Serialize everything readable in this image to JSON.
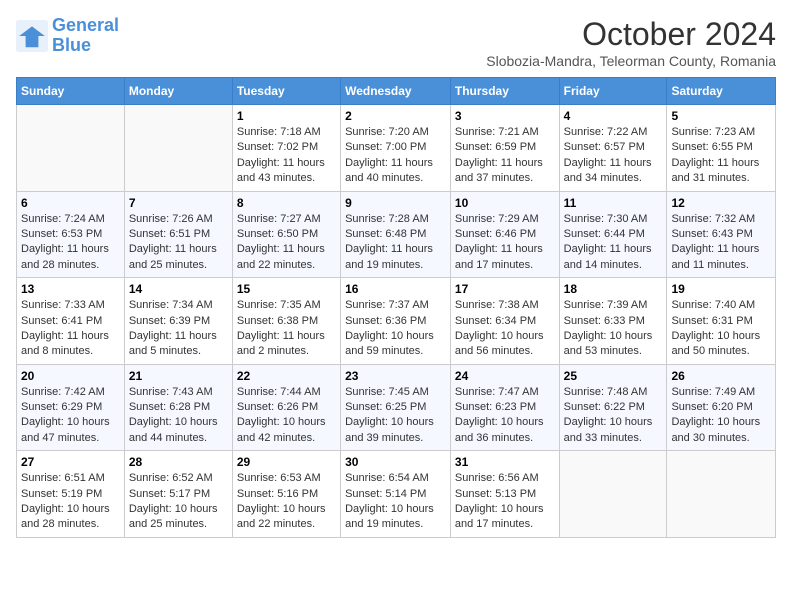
{
  "logo": {
    "line1": "General",
    "line2": "Blue"
  },
  "title": "October 2024",
  "subtitle": "Slobozia-Mandra, Teleorman County, Romania",
  "days_of_week": [
    "Sunday",
    "Monday",
    "Tuesday",
    "Wednesday",
    "Thursday",
    "Friday",
    "Saturday"
  ],
  "weeks": [
    [
      {
        "day": "",
        "sunrise": "",
        "sunset": "",
        "daylight": ""
      },
      {
        "day": "",
        "sunrise": "",
        "sunset": "",
        "daylight": ""
      },
      {
        "day": "1",
        "sunrise": "Sunrise: 7:18 AM",
        "sunset": "Sunset: 7:02 PM",
        "daylight": "Daylight: 11 hours and 43 minutes."
      },
      {
        "day": "2",
        "sunrise": "Sunrise: 7:20 AM",
        "sunset": "Sunset: 7:00 PM",
        "daylight": "Daylight: 11 hours and 40 minutes."
      },
      {
        "day": "3",
        "sunrise": "Sunrise: 7:21 AM",
        "sunset": "Sunset: 6:59 PM",
        "daylight": "Daylight: 11 hours and 37 minutes."
      },
      {
        "day": "4",
        "sunrise": "Sunrise: 7:22 AM",
        "sunset": "Sunset: 6:57 PM",
        "daylight": "Daylight: 11 hours and 34 minutes."
      },
      {
        "day": "5",
        "sunrise": "Sunrise: 7:23 AM",
        "sunset": "Sunset: 6:55 PM",
        "daylight": "Daylight: 11 hours and 31 minutes."
      }
    ],
    [
      {
        "day": "6",
        "sunrise": "Sunrise: 7:24 AM",
        "sunset": "Sunset: 6:53 PM",
        "daylight": "Daylight: 11 hours and 28 minutes."
      },
      {
        "day": "7",
        "sunrise": "Sunrise: 7:26 AM",
        "sunset": "Sunset: 6:51 PM",
        "daylight": "Daylight: 11 hours and 25 minutes."
      },
      {
        "day": "8",
        "sunrise": "Sunrise: 7:27 AM",
        "sunset": "Sunset: 6:50 PM",
        "daylight": "Daylight: 11 hours and 22 minutes."
      },
      {
        "day": "9",
        "sunrise": "Sunrise: 7:28 AM",
        "sunset": "Sunset: 6:48 PM",
        "daylight": "Daylight: 11 hours and 19 minutes."
      },
      {
        "day": "10",
        "sunrise": "Sunrise: 7:29 AM",
        "sunset": "Sunset: 6:46 PM",
        "daylight": "Daylight: 11 hours and 17 minutes."
      },
      {
        "day": "11",
        "sunrise": "Sunrise: 7:30 AM",
        "sunset": "Sunset: 6:44 PM",
        "daylight": "Daylight: 11 hours and 14 minutes."
      },
      {
        "day": "12",
        "sunrise": "Sunrise: 7:32 AM",
        "sunset": "Sunset: 6:43 PM",
        "daylight": "Daylight: 11 hours and 11 minutes."
      }
    ],
    [
      {
        "day": "13",
        "sunrise": "Sunrise: 7:33 AM",
        "sunset": "Sunset: 6:41 PM",
        "daylight": "Daylight: 11 hours and 8 minutes."
      },
      {
        "day": "14",
        "sunrise": "Sunrise: 7:34 AM",
        "sunset": "Sunset: 6:39 PM",
        "daylight": "Daylight: 11 hours and 5 minutes."
      },
      {
        "day": "15",
        "sunrise": "Sunrise: 7:35 AM",
        "sunset": "Sunset: 6:38 PM",
        "daylight": "Daylight: 11 hours and 2 minutes."
      },
      {
        "day": "16",
        "sunrise": "Sunrise: 7:37 AM",
        "sunset": "Sunset: 6:36 PM",
        "daylight": "Daylight: 10 hours and 59 minutes."
      },
      {
        "day": "17",
        "sunrise": "Sunrise: 7:38 AM",
        "sunset": "Sunset: 6:34 PM",
        "daylight": "Daylight: 10 hours and 56 minutes."
      },
      {
        "day": "18",
        "sunrise": "Sunrise: 7:39 AM",
        "sunset": "Sunset: 6:33 PM",
        "daylight": "Daylight: 10 hours and 53 minutes."
      },
      {
        "day": "19",
        "sunrise": "Sunrise: 7:40 AM",
        "sunset": "Sunset: 6:31 PM",
        "daylight": "Daylight: 10 hours and 50 minutes."
      }
    ],
    [
      {
        "day": "20",
        "sunrise": "Sunrise: 7:42 AM",
        "sunset": "Sunset: 6:29 PM",
        "daylight": "Daylight: 10 hours and 47 minutes."
      },
      {
        "day": "21",
        "sunrise": "Sunrise: 7:43 AM",
        "sunset": "Sunset: 6:28 PM",
        "daylight": "Daylight: 10 hours and 44 minutes."
      },
      {
        "day": "22",
        "sunrise": "Sunrise: 7:44 AM",
        "sunset": "Sunset: 6:26 PM",
        "daylight": "Daylight: 10 hours and 42 minutes."
      },
      {
        "day": "23",
        "sunrise": "Sunrise: 7:45 AM",
        "sunset": "Sunset: 6:25 PM",
        "daylight": "Daylight: 10 hours and 39 minutes."
      },
      {
        "day": "24",
        "sunrise": "Sunrise: 7:47 AM",
        "sunset": "Sunset: 6:23 PM",
        "daylight": "Daylight: 10 hours and 36 minutes."
      },
      {
        "day": "25",
        "sunrise": "Sunrise: 7:48 AM",
        "sunset": "Sunset: 6:22 PM",
        "daylight": "Daylight: 10 hours and 33 minutes."
      },
      {
        "day": "26",
        "sunrise": "Sunrise: 7:49 AM",
        "sunset": "Sunset: 6:20 PM",
        "daylight": "Daylight: 10 hours and 30 minutes."
      }
    ],
    [
      {
        "day": "27",
        "sunrise": "Sunrise: 6:51 AM",
        "sunset": "Sunset: 5:19 PM",
        "daylight": "Daylight: 10 hours and 28 minutes."
      },
      {
        "day": "28",
        "sunrise": "Sunrise: 6:52 AM",
        "sunset": "Sunset: 5:17 PM",
        "daylight": "Daylight: 10 hours and 25 minutes."
      },
      {
        "day": "29",
        "sunrise": "Sunrise: 6:53 AM",
        "sunset": "Sunset: 5:16 PM",
        "daylight": "Daylight: 10 hours and 22 minutes."
      },
      {
        "day": "30",
        "sunrise": "Sunrise: 6:54 AM",
        "sunset": "Sunset: 5:14 PM",
        "daylight": "Daylight: 10 hours and 19 minutes."
      },
      {
        "day": "31",
        "sunrise": "Sunrise: 6:56 AM",
        "sunset": "Sunset: 5:13 PM",
        "daylight": "Daylight: 10 hours and 17 minutes."
      },
      {
        "day": "",
        "sunrise": "",
        "sunset": "",
        "daylight": ""
      },
      {
        "day": "",
        "sunrise": "",
        "sunset": "",
        "daylight": ""
      }
    ]
  ]
}
